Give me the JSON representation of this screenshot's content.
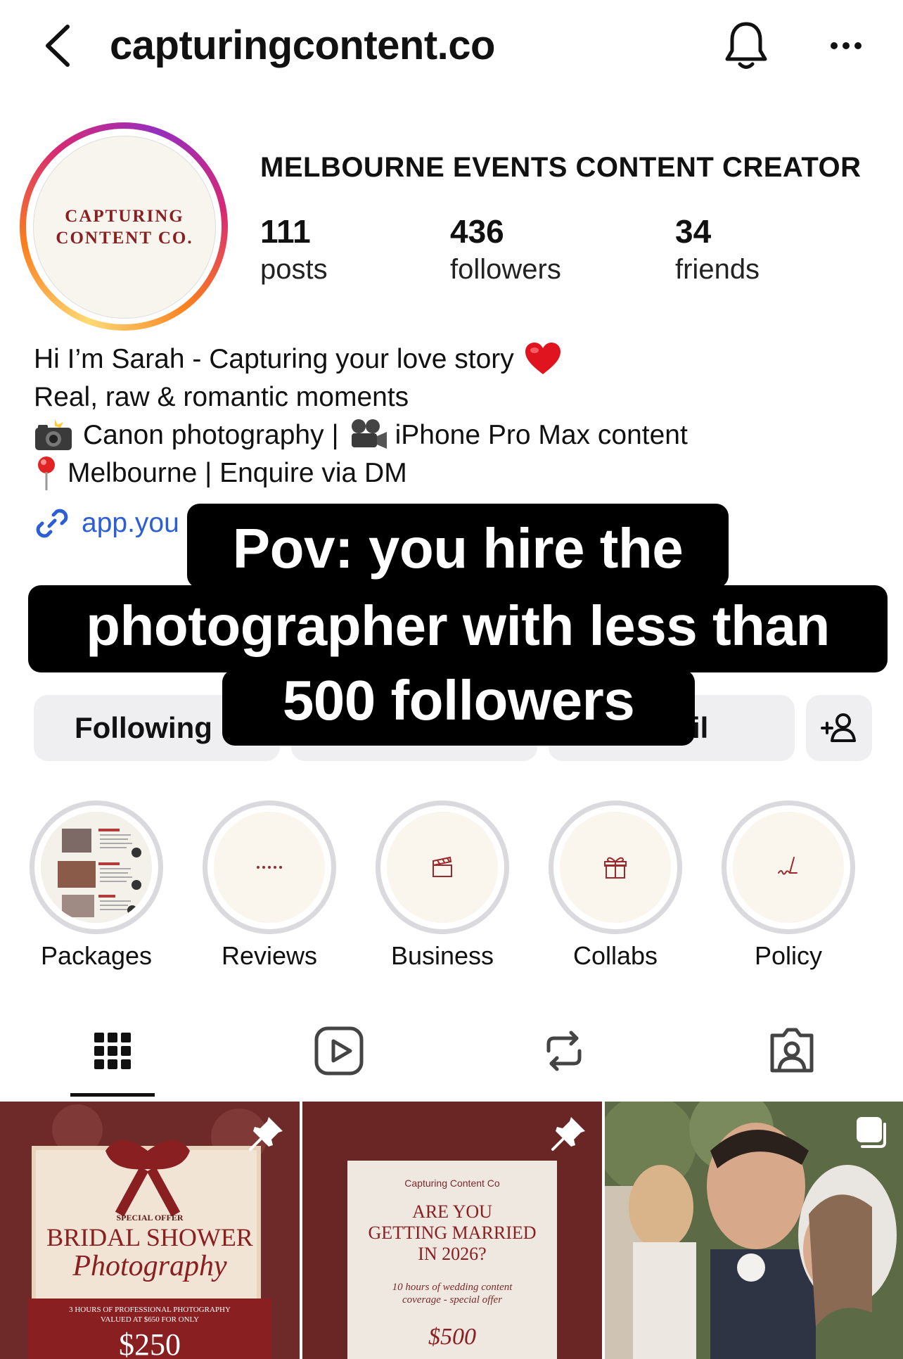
{
  "header": {
    "username": "capturingcontent.co"
  },
  "profile": {
    "avatar_text_line1": "CAPTURING",
    "avatar_text_line2": "CONTENT CO.",
    "category": "MELBOURNE EVENTS CONTENT CREATOR",
    "stats": [
      {
        "value": "111",
        "label": "posts"
      },
      {
        "value": "436",
        "label": "followers"
      },
      {
        "value": "34",
        "label": "friends"
      }
    ],
    "bio": [
      "Hi I’m Sarah - Capturing your love story",
      "Real, raw & romantic moments",
      "Canon photography |",
      "iPhone Pro Max content",
      "Melbourne | Enquire via DM"
    ],
    "link": "app.you"
  },
  "buttons": {
    "following": "Following",
    "email_partial": "il"
  },
  "overlay": {
    "line1": "Pov: you hire the",
    "line2": "photographer with less than",
    "line3": "500 followers"
  },
  "highlights": [
    {
      "label": "Packages",
      "icon": "packages-collage"
    },
    {
      "label": "Reviews",
      "icon": "dots-icon"
    },
    {
      "label": "Business",
      "icon": "clapperboard-icon"
    },
    {
      "label": "Collabs",
      "icon": "gift-icon"
    },
    {
      "label": "Policy",
      "icon": "signature-icon"
    }
  ],
  "tabs": [
    "grid-icon",
    "reels-icon",
    "reposts-icon",
    "tagged-icon"
  ],
  "posts": [
    {
      "kicker": "SPECIAL OFFER",
      "title": "BRIDAL SHOWER",
      "script": "Photography",
      "details_line1": "3 HOURS OF PROFESSIONAL PHOTOGRAPHY",
      "details_line2": "VALUED AT $650 FOR ONLY",
      "price": "$250"
    },
    {
      "brand": "Capturing Content Co",
      "title_line1": "ARE YOU",
      "title_line2": "GETTING MARRIED",
      "title_line3": "IN 2026?",
      "sub_line1": "10 hours of wedding content",
      "sub_line2": "coverage - special offer",
      "price": "$500"
    },
    {
      "type": "photo"
    }
  ],
  "colors": {
    "accent_red": "#8a1f22",
    "link_blue": "#2c5fd6",
    "button_bg": "#efeff2"
  }
}
